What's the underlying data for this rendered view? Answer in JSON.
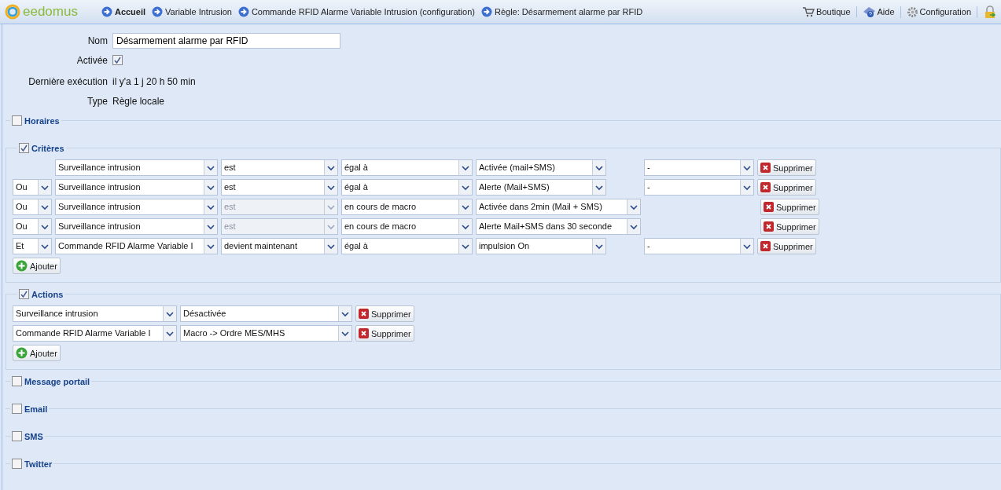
{
  "topbar": {
    "logo": "eedomus",
    "breadcrumbs": [
      {
        "label": "Accueil",
        "current": true
      },
      {
        "label": "Variable Intrusion",
        "current": false
      },
      {
        "label": "Commande RFID Alarme Variable Intrusion (configuration)",
        "current": false
      },
      {
        "label": "Règle: Désarmement alarme par RFID",
        "current": false
      }
    ],
    "links": [
      {
        "kind": "cart",
        "label": "Boutique"
      },
      {
        "kind": "help",
        "label": "Aide"
      },
      {
        "kind": "gear",
        "label": "Configuration"
      }
    ]
  },
  "form": {
    "name_label": "Nom",
    "name_value": "Désarmement alarme par RFID",
    "active_label": "Activée",
    "active_checked": true,
    "last_label": "Dernière exécution",
    "last_value": "il y'a 1 j 20 h 50 min",
    "type_label": "Type",
    "type_value": "Règle locale"
  },
  "sections": [
    {
      "kind": "empty",
      "title": "Horaires",
      "checked": false
    },
    {
      "kind": "criteria",
      "title": "Critères",
      "checked": true,
      "add_label": "Ajouter",
      "rows": [
        {
          "conj": null,
          "device": "Surveillance intrusion",
          "op": "est",
          "op_disabled": false,
          "cmp": "égal à",
          "value": "Activée (mail+SMS)",
          "extra": "-",
          "delete": "Supprimer"
        },
        {
          "conj": "Ou",
          "device": "Surveillance intrusion",
          "op": "est",
          "op_disabled": false,
          "cmp": "égal à",
          "value": "Alerte (Mail+SMS)",
          "extra": "-",
          "delete": "Supprimer"
        },
        {
          "conj": "Ou",
          "device": "Surveillance intrusion",
          "op": "est",
          "op_disabled": true,
          "cmp": "en cours de macro",
          "value": "Activée dans 2min (Mail + SMS)",
          "extra": null,
          "delete": "Supprimer"
        },
        {
          "conj": "Ou",
          "device": "Surveillance intrusion",
          "op": "est",
          "op_disabled": true,
          "cmp": "en cours de macro",
          "value": "Alerte Mail+SMS dans 30 seconde",
          "extra": null,
          "delete": "Supprimer"
        },
        {
          "conj": "Et",
          "device": "Commande RFID Alarme Variable I",
          "op": "devient maintenant",
          "op_disabled": false,
          "cmp": "égal à",
          "value": "impulsion On",
          "extra": "-",
          "delete": "Supprimer"
        }
      ]
    },
    {
      "kind": "actions",
      "title": "Actions",
      "checked": true,
      "add_label": "Ajouter",
      "rows": [
        {
          "device": "Surveillance intrusion",
          "action": "Désactivée",
          "delete": "Supprimer"
        },
        {
          "device": "Commande RFID Alarme Variable I",
          "action": "Macro -> Ordre MES/MHS",
          "delete": "Supprimer"
        }
      ]
    },
    {
      "kind": "empty",
      "title": "Message portail",
      "checked": false
    },
    {
      "kind": "empty",
      "title": "Email",
      "checked": false
    },
    {
      "kind": "empty",
      "title": "SMS",
      "checked": false
    },
    {
      "kind": "empty",
      "title": "Twitter",
      "checked": false
    }
  ]
}
